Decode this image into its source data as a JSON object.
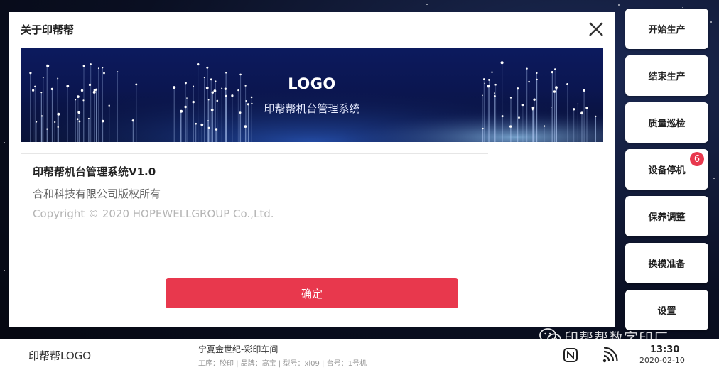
{
  "dialog": {
    "title": "关于印帮帮",
    "banner_logo": "LOGO",
    "banner_subtitle": "印帮帮机台管理系统",
    "product_name": "印帮帮机台管理系统V1.0",
    "owner": "合和科技有限公司版权所有",
    "copyright": "Copyright © 2020  HOPEWELLGROUP  Co.,Ltd.",
    "confirm_label": "确定"
  },
  "sidebar": {
    "buttons": [
      {
        "label": "开始生产"
      },
      {
        "label": "结束生产"
      },
      {
        "label": "质量巡检"
      },
      {
        "label": "设备停机",
        "badge": "6"
      },
      {
        "label": "保养调整"
      },
      {
        "label": "换模准备"
      },
      {
        "label": "设置"
      }
    ]
  },
  "footer": {
    "logo": "印帮帮LOGO",
    "workshop": "宁夏金世纪-彩印车间",
    "meta": "工序：胶印 | 品牌：高宝 | 型号：xl09 | 台号：1号机",
    "time": "13:30",
    "date": "2020-02-10"
  },
  "watermark": "印帮帮数字印厂",
  "colors": {
    "accent": "#e8384d",
    "banner": "#0c1a5e"
  }
}
